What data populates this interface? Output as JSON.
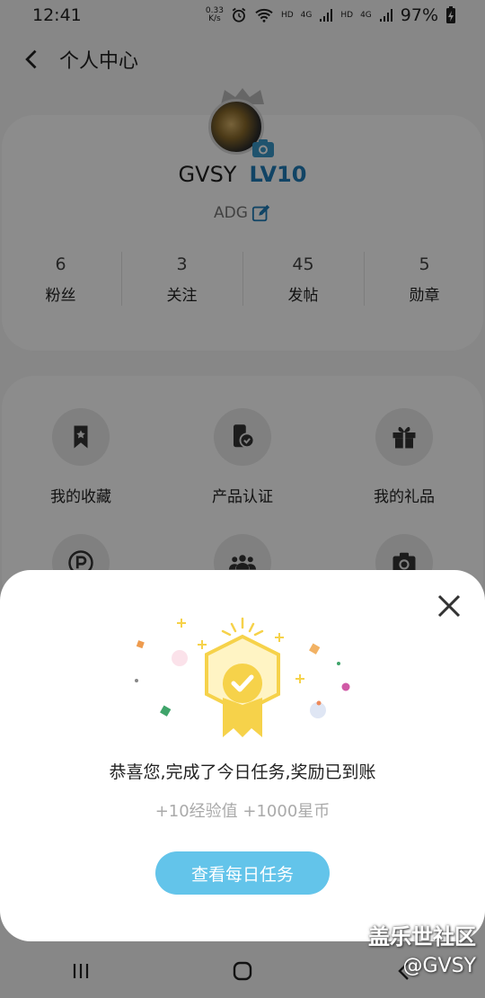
{
  "status": {
    "time": "12:41",
    "net_speed_value": "0.33",
    "net_speed_unit": "K/s",
    "hd1": "HD",
    "net1": "4G",
    "hd2": "HD",
    "net2": "4G",
    "battery": "97%"
  },
  "header": {
    "title": "个人中心"
  },
  "profile": {
    "username": "GVSY",
    "level": "LV10",
    "signature": "ADG",
    "stats": [
      {
        "value": "6",
        "label": "粉丝"
      },
      {
        "value": "3",
        "label": "关注"
      },
      {
        "value": "45",
        "label": "发帖"
      },
      {
        "value": "5",
        "label": "勋章"
      }
    ]
  },
  "menu": {
    "items": [
      {
        "label": "我的收藏",
        "icon": "bookmark-icon"
      },
      {
        "label": "产品认证",
        "icon": "phone-check-icon"
      },
      {
        "label": "我的礼品",
        "icon": "gift-icon"
      },
      {
        "label": "",
        "icon": "points-p-icon"
      },
      {
        "label": "",
        "icon": "group-icon"
      },
      {
        "label": "",
        "icon": "camera-icon"
      }
    ]
  },
  "modal": {
    "message": "恭喜您,完成了今日任务,奖励已到账",
    "reward": "+10经验值 +1000星币",
    "button": "查看每日任务"
  },
  "watermark": {
    "line1": "盖乐世社区",
    "line2": "@GVSY"
  },
  "colors": {
    "accent": "#63c4ea",
    "level": "#1f7db8",
    "badge": "#f6d24a"
  }
}
